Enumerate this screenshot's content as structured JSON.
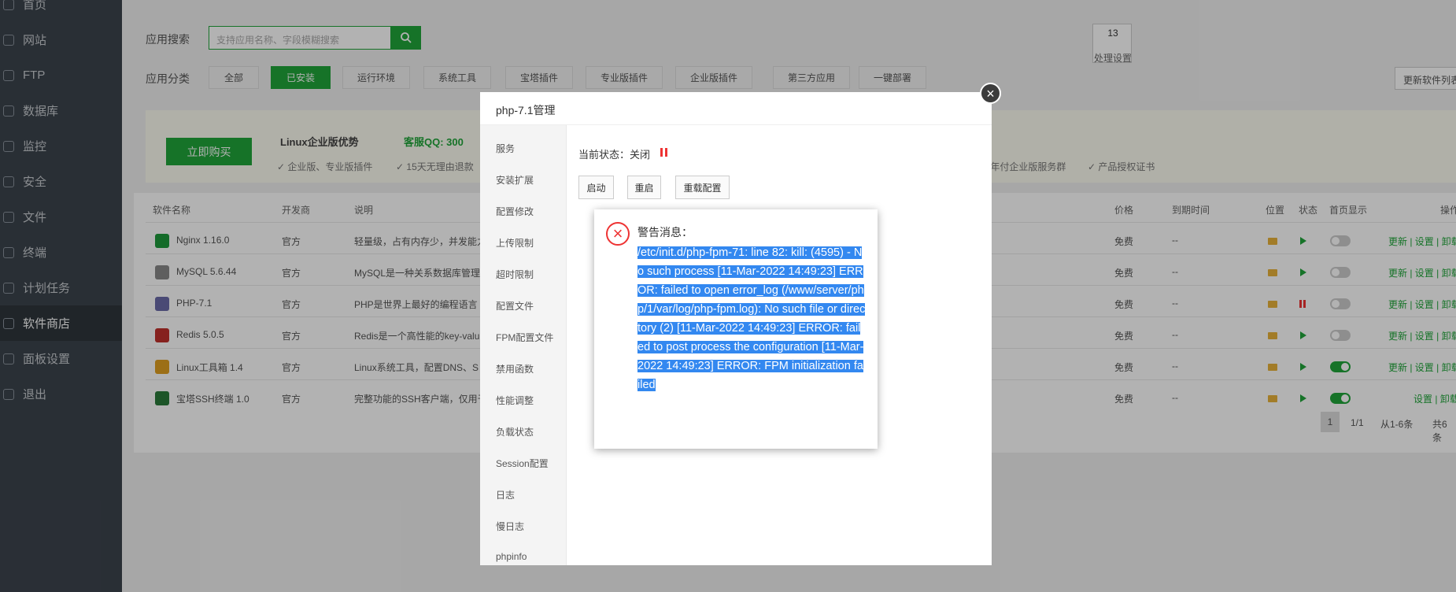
{
  "sidebar": {
    "items": [
      {
        "label": "首页",
        "icon": "home-icon"
      },
      {
        "label": "网站",
        "icon": "globe-icon"
      },
      {
        "label": "FTP",
        "icon": "ftp-icon"
      },
      {
        "label": "数据库",
        "icon": "database-icon"
      },
      {
        "label": "监控",
        "icon": "monitor-icon"
      },
      {
        "label": "安全",
        "icon": "shield-icon"
      },
      {
        "label": "文件",
        "icon": "folder-icon"
      },
      {
        "label": "终端",
        "icon": "terminal-icon"
      },
      {
        "label": "计划任务",
        "icon": "calendar-icon"
      },
      {
        "label": "软件商店",
        "icon": "apps-icon",
        "active": true
      },
      {
        "label": "面板设置",
        "icon": "gear-icon"
      },
      {
        "label": "退出",
        "icon": "logout-icon"
      }
    ]
  },
  "search": {
    "label": "应用搜索",
    "placeholder": "支持应用名称、字段模糊搜索"
  },
  "category": {
    "label": "应用分类",
    "items": [
      "全部",
      "已安装",
      "运行环境",
      "系统工具",
      "宝塔插件",
      "专业版插件",
      "企业版插件",
      "第三方应用",
      "一键部署"
    ],
    "active": "已安装"
  },
  "page_box": {
    "number": "13",
    "text": "处理设置"
  },
  "update_button": "更新软件列表",
  "banner": {
    "buy_label": "立即购买",
    "title": "Linux企业版优势",
    "qq": "客服QQ: 300",
    "features": [
      "企业版、专业版插件",
      "15天无理由退款",
      "年付企业版服务群",
      "产品授权证书"
    ]
  },
  "table": {
    "headers": {
      "name": "软件名称",
      "dev": "开发商",
      "desc": "说明",
      "price": "价格",
      "expire": "到期时间",
      "location": "位置",
      "status": "状态",
      "home": "首页显示",
      "ops": "操作"
    },
    "rows": [
      {
        "name": "Nginx 1.16.0",
        "dev": "官方",
        "desc": "轻量级，占有内存少，并发能力",
        "price": "免费",
        "expire": "--",
        "running": true,
        "home": false,
        "ops": "更新 | 设置 | 卸载"
      },
      {
        "name": "MySQL 5.6.44",
        "dev": "官方",
        "desc": "MySQL是一种关系数据库管理",
        "price": "免费",
        "expire": "--",
        "running": true,
        "home": false,
        "ops": "更新 | 设置 | 卸载"
      },
      {
        "name": "PHP-7.1",
        "dev": "官方",
        "desc": "PHP是世界上最好的编程语言",
        "price": "免费",
        "expire": "--",
        "running": false,
        "home": false,
        "ops": "更新 | 设置 | 卸载"
      },
      {
        "name": "Redis 5.0.5",
        "dev": "官方",
        "desc": "Redis是一个高性能的key-valu",
        "price": "免费",
        "expire": "--",
        "running": true,
        "home": false,
        "ops": "更新 | 设置 | 卸载"
      },
      {
        "name": "Linux工具箱 1.4",
        "dev": "官方",
        "desc": "Linux系统工具，配置DNS、S",
        "price": "免费",
        "expire": "--",
        "running": true,
        "home": true,
        "ops": "更新 | 设置 | 卸载"
      },
      {
        "name": "宝塔SSH终端 1.0",
        "dev": "官方",
        "desc": "完整功能的SSH客户端，仅用于",
        "price": "免费",
        "expire": "--",
        "running": true,
        "home": true,
        "ops": "设置 | 卸载"
      }
    ]
  },
  "pagination": {
    "current": "1",
    "pages": "1/1",
    "range": "从1-6条",
    "total": "共6条"
  },
  "modal": {
    "title": "php-7.1管理",
    "menu": [
      "服务",
      "安装扩展",
      "配置修改",
      "上传限制",
      "超时限制",
      "配置文件",
      "FPM配置文件",
      "禁用函数",
      "性能调整",
      "负载状态",
      "Session配置",
      "日志",
      "慢日志",
      "phpinfo"
    ],
    "status_label": "当前状态：关闭",
    "buttons": [
      "启动",
      "重启",
      "重载配置"
    ]
  },
  "alert": {
    "title": "警告消息：",
    "message": "/etc/init.d/php-fpm-71: line 82: kill: (4595) - No such process [11-Mar-2022 14:49:23] ERROR: failed to open error_log (/www/server/php/1/var/log/php-fpm.log): No such file or directory (2) [11-Mar-2022 14:49:23] ERROR: failed to post process the configuration [11-Mar-2022 14:49:23] ERROR: FPM initialization failed"
  }
}
